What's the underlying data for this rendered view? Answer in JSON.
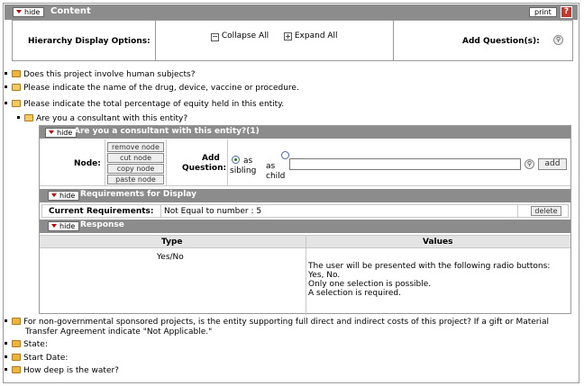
{
  "header": {
    "hide": "hide",
    "title": "Content",
    "print": "print",
    "help": "?"
  },
  "hierarchy": {
    "label": "Hierarchy Display Options:",
    "collapse_all": "Collapse All",
    "expand_all": "Expand All",
    "add_questions": "Add Question(s):"
  },
  "tree": {
    "q1": "Does this project involve human subjects?",
    "q2": "Please indicate the name of the drug, device, vaccine or procedure.",
    "q3": "Please indicate the total percentage of equity held in this entity.",
    "q4": "Are you a consultant with this entity?",
    "q5_line1": "For non-governmental sponsored projects, is the entity supporting full direct and indirect costs of this project? If a gift or Material",
    "q5_line2": "Transfer Agreement indicate \"Not Applicable.\"",
    "q6": "State:",
    "q7": "Start Date:",
    "q8": "How deep is the water?"
  },
  "consultant_panel": {
    "hide": "hide",
    "title": "Are you a consultant with this entity?(1)",
    "node_label": "Node:",
    "remove_node": "remove node",
    "cut_node": "cut node",
    "copy_node": "copy node",
    "paste_node": "paste node",
    "add_question_l1": "Add",
    "add_question_l2": "Question:",
    "as_sibling_l1": "as",
    "as_sibling_l2": "sibling",
    "as_child_l1": "as",
    "as_child_l2": "child",
    "add_button": "add",
    "search_icon": "magnifier"
  },
  "requirements": {
    "hide": "hide",
    "title": "Requirements for Display",
    "current_label": "Current Requirements:",
    "current_value": "Not Equal to number : 5",
    "delete": "delete"
  },
  "response": {
    "hide": "hide",
    "title": "Response",
    "col_type": "Type",
    "col_values": "Values",
    "type_value": "Yes/No",
    "values_line1": "The user will be presented with the following radio buttons:",
    "values_line2": "Yes, No.",
    "values_line3": "Only one selection is possible.",
    "values_line4": "A selection is required."
  },
  "colors": {
    "bar": "#8c8c8c",
    "folder": "#f0b43c",
    "accent_red": "#c00000"
  }
}
